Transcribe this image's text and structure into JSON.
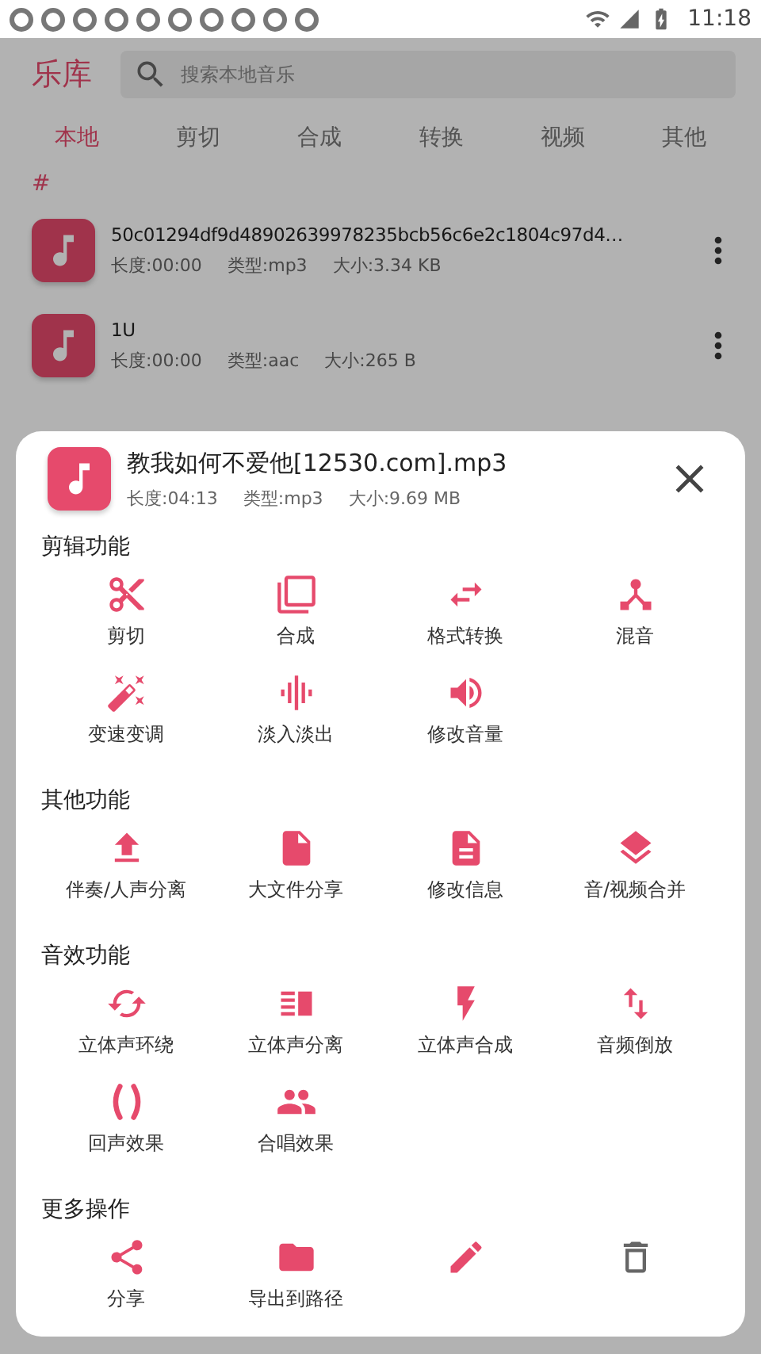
{
  "status_bar": {
    "time": "11:18"
  },
  "header": {
    "title": "乐库",
    "search": {
      "placeholder": "搜索本地音乐"
    }
  },
  "tabs": [
    {
      "label": "本地",
      "selected": true
    },
    {
      "label": "剪切",
      "selected": false
    },
    {
      "label": "合成",
      "selected": false
    },
    {
      "label": "转换",
      "selected": false
    },
    {
      "label": "视频",
      "selected": false
    },
    {
      "label": "其他",
      "selected": false
    }
  ],
  "section_letter": "#",
  "songs": [
    {
      "name": "50c01294df9d48902639978235bcb56c6e2c1804c97d4…",
      "length": "长度:00:00",
      "type": "类型:mp3",
      "size": "大小:3.34 KB"
    },
    {
      "name": "1U",
      "length": "长度:00:00",
      "type": "类型:aac",
      "size": "大小:265 B"
    }
  ],
  "sheet": {
    "title": "教我如何不爱他[12530.com].mp3",
    "length": "长度:04:13",
    "type": "类型:mp3",
    "size": "大小:9.69 MB",
    "sections": [
      {
        "heading": "剪辑功能",
        "items": [
          {
            "label": "剪切"
          },
          {
            "label": "合成"
          },
          {
            "label": "格式转换"
          },
          {
            "label": "混音"
          },
          {
            "label": "变速变调"
          },
          {
            "label": "淡入淡出"
          },
          {
            "label": "修改音量"
          }
        ]
      },
      {
        "heading": "其他功能",
        "items": [
          {
            "label": "伴奏/人声分离"
          },
          {
            "label": "大文件分享"
          },
          {
            "label": "修改信息"
          },
          {
            "label": "音/视频合并"
          }
        ]
      },
      {
        "heading": "音效功能",
        "items": [
          {
            "label": "立体声环绕"
          },
          {
            "label": "立体声分离"
          },
          {
            "label": "立体声合成"
          },
          {
            "label": "音频倒放"
          },
          {
            "label": "回声效果"
          },
          {
            "label": "合唱效果"
          }
        ]
      },
      {
        "heading": "更多操作",
        "items": [
          {
            "kind": "labeled",
            "label": "分享"
          },
          {
            "kind": "labeled",
            "label": "导出到路径"
          },
          {
            "kind": "icon"
          },
          {
            "kind": "icon"
          }
        ]
      }
    ]
  }
}
